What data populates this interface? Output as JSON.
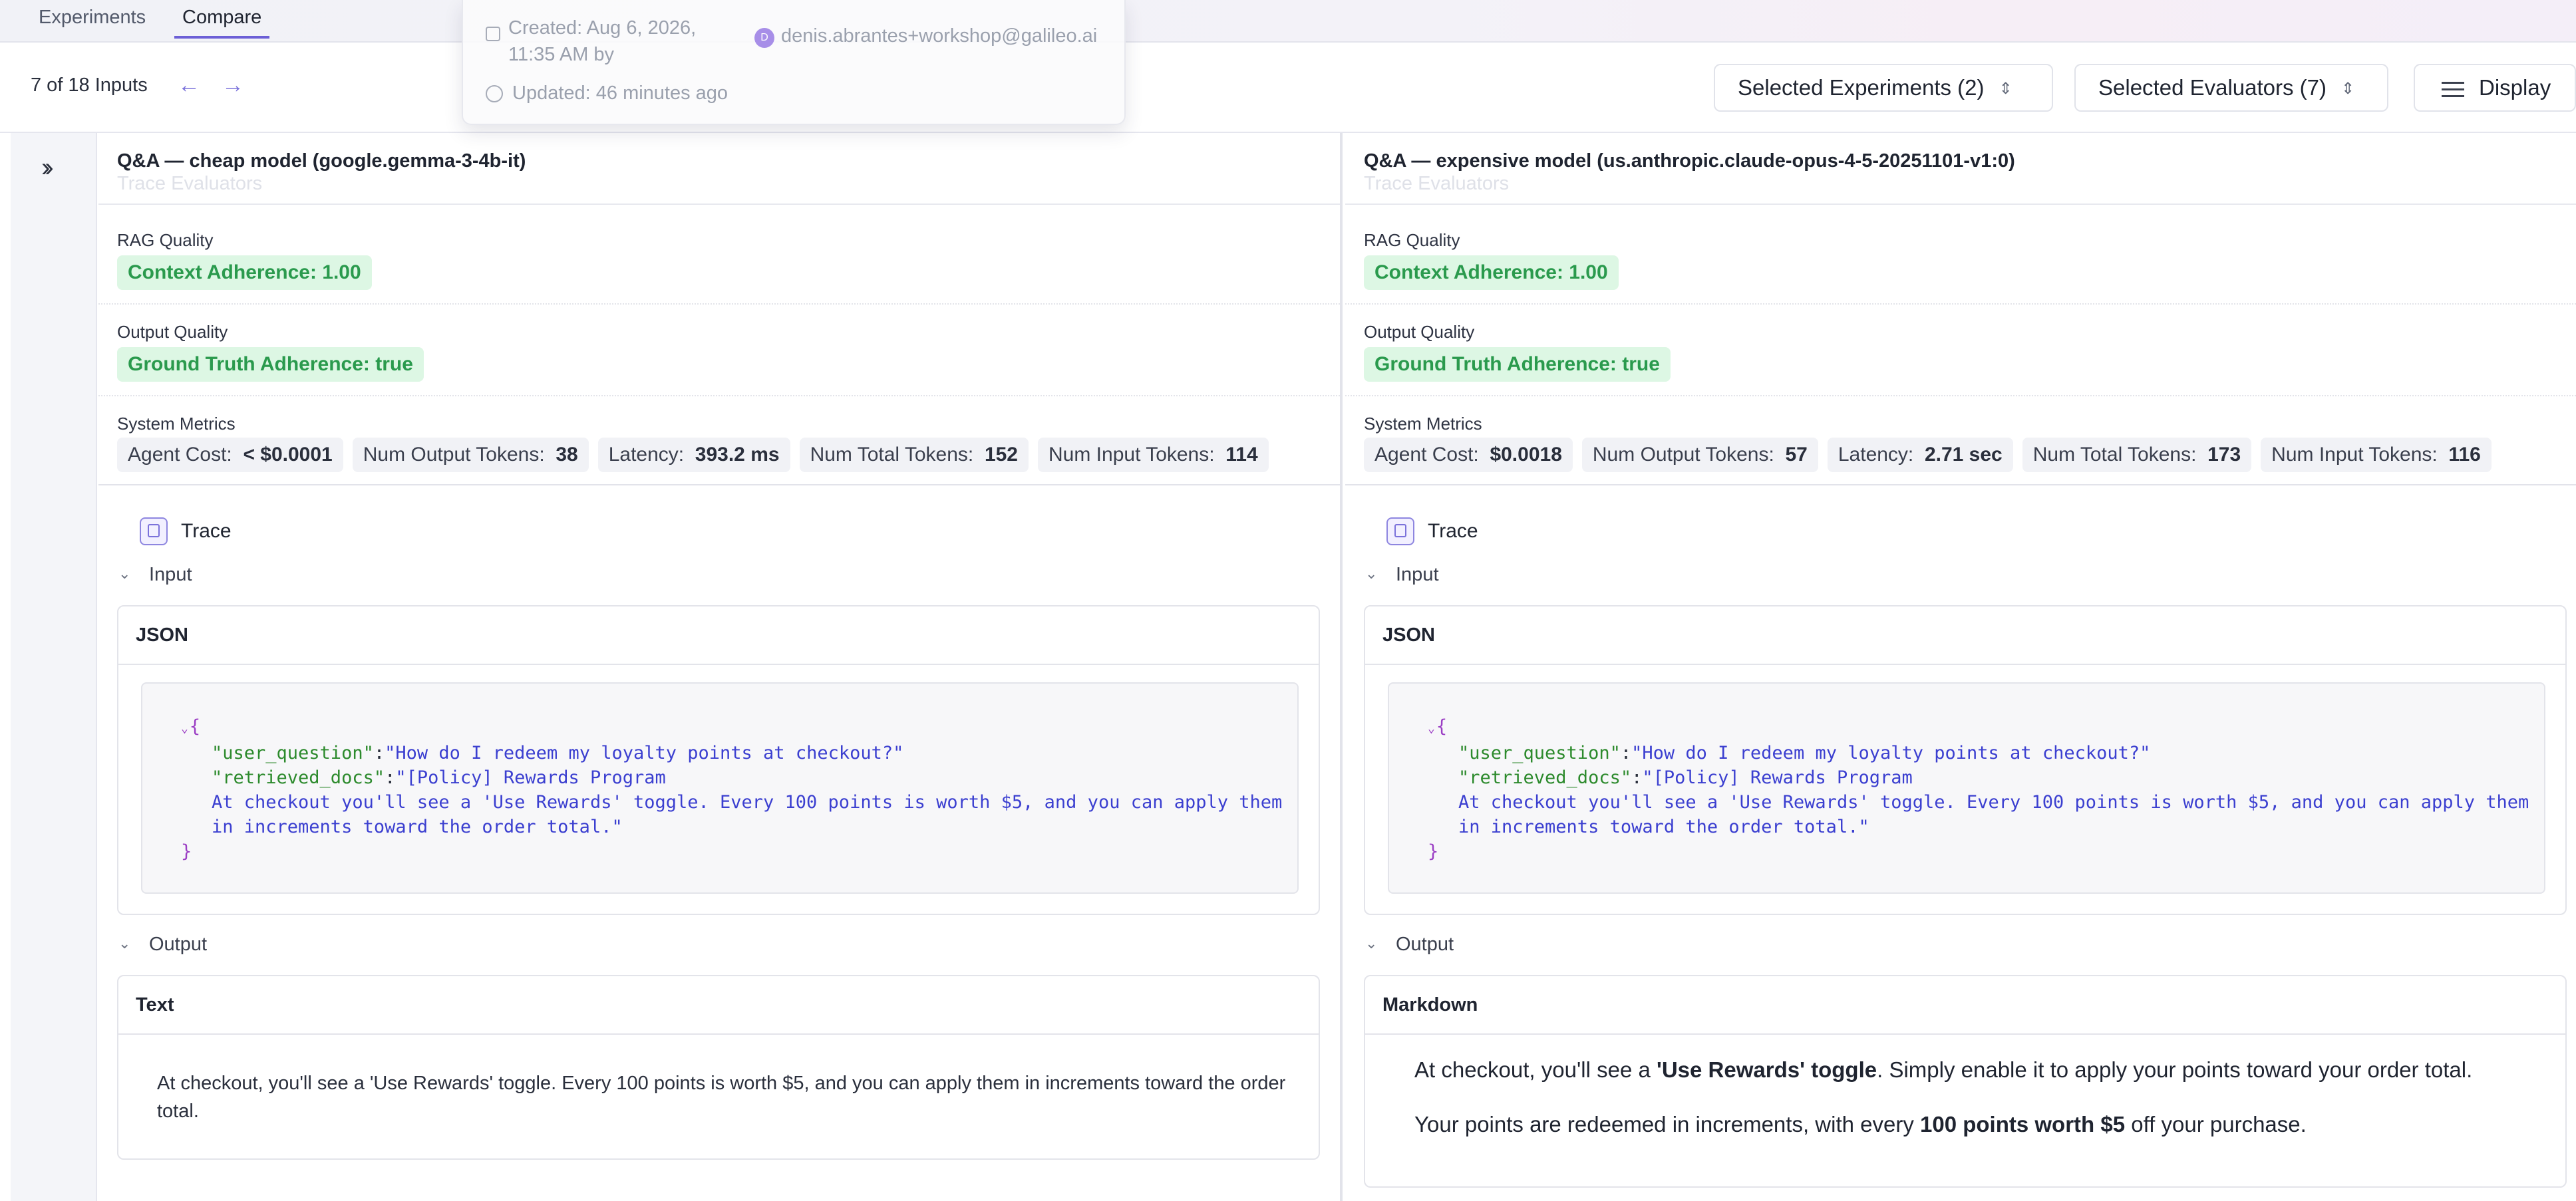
{
  "tabs": {
    "experiments": "Experiments",
    "compare": "Compare"
  },
  "header": {
    "inputs_count": "7 of 18 Inputs",
    "selected_experiments": "Selected Experiments (2)",
    "selected_evaluators": "Selected Evaluators (7)",
    "display": "Display"
  },
  "popover": {
    "created": "Created: Aug 6, 2026, 11:35 AM by",
    "avatar_initial": "D",
    "email": "denis.abrantes+workshop@galileo.ai",
    "updated": "Updated: 46 minutes ago"
  },
  "colors": {
    "accent": "#6c5fd6",
    "success_bg": "#ddf7e4",
    "success_text": "#2a9a4d"
  },
  "icons": [
    "double-chevron-right-icon",
    "arrow-left-icon",
    "arrow-right-icon",
    "updown-chevron-icon",
    "sliders-icon",
    "trace-icon",
    "chevron-down-icon",
    "calendar-icon",
    "clock-icon"
  ],
  "columns": [
    {
      "title": "Q&A — cheap model (google.gemma-3-4b-it)",
      "ghost": "Trace Evaluators",
      "rag_label": "RAG Quality",
      "rag_metric": "Context Adherence:  1.00",
      "output_label": "Output Quality",
      "output_metric": "Ground Truth Adherence:  true",
      "system_label": "System Metrics",
      "metrics": [
        {
          "k": "Agent Cost:",
          "v": "< $0.0001"
        },
        {
          "k": "Num Output Tokens:",
          "v": "38"
        },
        {
          "k": "Latency:",
          "v": "393.2 ms"
        },
        {
          "k": "Num Total Tokens:",
          "v": "152"
        },
        {
          "k": "Num Input Tokens:",
          "v": "114"
        }
      ],
      "trace": "Trace",
      "input_label": "Input",
      "input_card": "JSON",
      "output_label2": "Output",
      "output_card": "Text",
      "output_text": "At checkout, you'll see a 'Use Rewards' toggle. Every 100 points is worth $5, and you can apply them in increments toward the order total."
    },
    {
      "title": "Q&A — expensive model (us.anthropic.claude-opus-4-5-20251101-v1:0)",
      "ghost": "Trace Evaluators",
      "rag_label": "RAG Quality",
      "rag_metric": "Context Adherence:  1.00",
      "output_label": "Output Quality",
      "output_metric": "Ground Truth Adherence:  true",
      "system_label": "System Metrics",
      "metrics": [
        {
          "k": "Agent Cost:",
          "v": "$0.0018"
        },
        {
          "k": "Num Output Tokens:",
          "v": "57"
        },
        {
          "k": "Latency:",
          "v": "2.71 sec"
        },
        {
          "k": "Num Total Tokens:",
          "v": "173"
        },
        {
          "k": "Num Input Tokens:",
          "v": "116"
        }
      ],
      "trace": "Trace",
      "input_label": "Input",
      "input_card": "JSON",
      "output_label2": "Output",
      "output_card": "Markdown",
      "md_p1_a": "At checkout, you'll see a ",
      "md_p1_b": "'Use Rewards' toggle",
      "md_p1_c": ". Simply enable it to apply your points toward your order total.",
      "md_p2_a": "Your points are redeemed in increments, with every ",
      "md_p2_b": "100 points worth $5",
      "md_p2_c": " off your purchase."
    }
  ],
  "json_input": {
    "open": "{",
    "close": "}",
    "key1": "\"user_question\"",
    "val1": "\"How do I redeem my loyalty points at checkout?\"",
    "key2": "\"retrieved_docs\"",
    "val2_line1": "\"[Policy] Rewards Program",
    "val2_line2": "At checkout you'll see a 'Use Rewards' toggle. Every 100 points is worth $5, and you can apply them",
    "val2_line3": "in increments toward the order total.\""
  }
}
